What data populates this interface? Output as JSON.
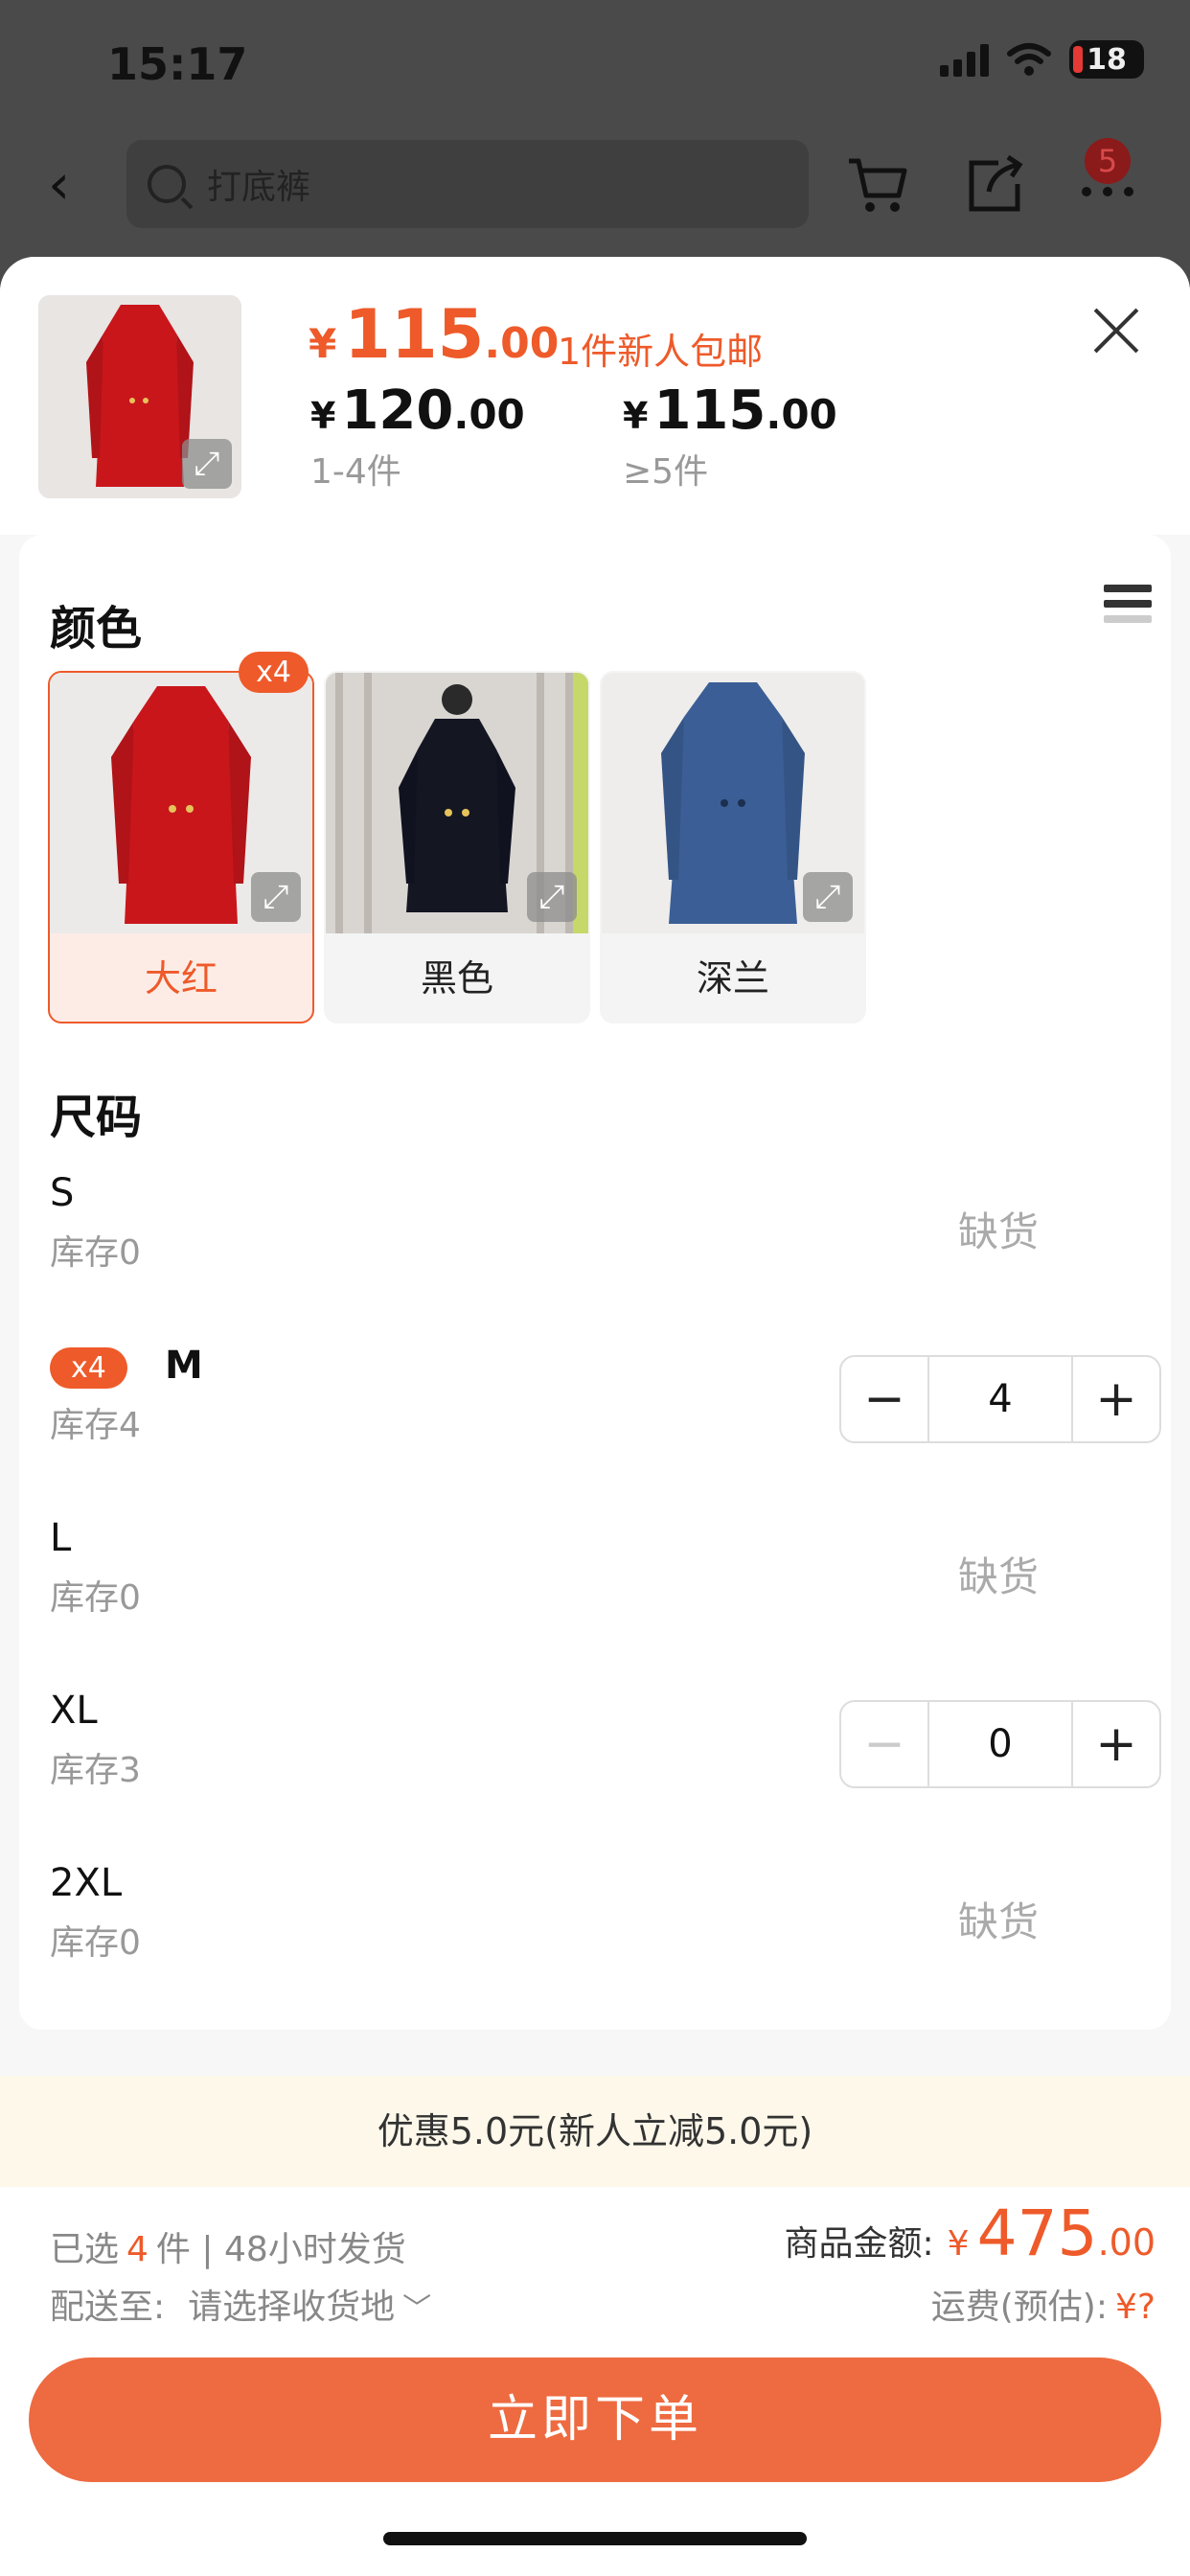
{
  "status_bar": {
    "time": "15:17",
    "battery": "18"
  },
  "nav": {
    "search_placeholder": "打底裤",
    "more_badge": "5"
  },
  "colors": {
    "accent": "#ee5a2a",
    "button": "#ee6a40",
    "discount_bg": "#fdf8ea"
  },
  "header": {
    "price_currency": "¥",
    "price_int": "115",
    "price_dec": ".00",
    "price_tag": "1件新人包邮",
    "tiers": [
      {
        "currency": "¥",
        "int": "120",
        "dec": ".00",
        "range": "1-4件"
      },
      {
        "currency": "¥",
        "int": "115",
        "dec": ".00",
        "range": "≥5件"
      }
    ]
  },
  "color_section": {
    "title": "颜色",
    "options": [
      {
        "name": "大红",
        "badge": "x4",
        "selected": true
      },
      {
        "name": "黑色"
      },
      {
        "name": "深兰"
      }
    ]
  },
  "size_section": {
    "title": "尺码",
    "rows": [
      {
        "size": "S",
        "stock": "库存0",
        "status": "缺货"
      },
      {
        "size": "M",
        "stock": "库存4",
        "badge": "x4",
        "quantity": "4"
      },
      {
        "size": "L",
        "stock": "库存0",
        "status": "缺货"
      },
      {
        "size": "XL",
        "stock": "库存3",
        "quantity": "0"
      },
      {
        "size": "2XL",
        "stock": "库存0",
        "status": "缺货"
      }
    ]
  },
  "discount": {
    "text": "优惠5.0元(新人立减5.0元)"
  },
  "footer": {
    "selected_prefix": "已选",
    "selected_count": "4",
    "selected_suffix": "件 | 48小时发货",
    "ship_label": "配送至:",
    "ship_address": "请选择收货地",
    "total_label": "商品金额:",
    "total_currency": "¥",
    "total_int": "475",
    "total_dec": ".00",
    "freight_label": "运费(预估):",
    "freight_value": "¥?",
    "order_button": "立即下单"
  }
}
